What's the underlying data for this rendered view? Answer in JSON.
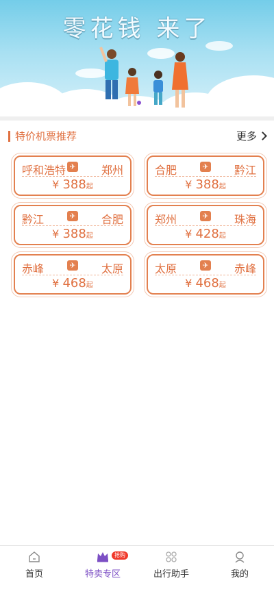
{
  "banner": {
    "title": "零花钱 来了"
  },
  "section": {
    "title": "特价机票推荐",
    "more_label": "更多"
  },
  "tickets": [
    {
      "from": "呼和浩特",
      "to": "郑州",
      "price": "388",
      "currency": "¥",
      "suffix": "起"
    },
    {
      "from": "合肥",
      "to": "黔江",
      "price": "388",
      "currency": "¥",
      "suffix": "起"
    },
    {
      "from": "黔江",
      "to": "合肥",
      "price": "388",
      "currency": "¥",
      "suffix": "起"
    },
    {
      "from": "郑州",
      "to": "珠海",
      "price": "428",
      "currency": "¥",
      "suffix": "起"
    },
    {
      "from": "赤峰",
      "to": "太原",
      "price": "468",
      "currency": "¥",
      "suffix": "起"
    },
    {
      "from": "太原",
      "to": "赤峰",
      "price": "468",
      "currency": "¥",
      "suffix": "起"
    }
  ],
  "nav": {
    "items": [
      {
        "label": "首页",
        "icon": "home-icon"
      },
      {
        "label": "特卖专区",
        "icon": "crown-icon",
        "badge": "抢购",
        "active": true
      },
      {
        "label": "出行助手",
        "icon": "grid-icon"
      },
      {
        "label": "我的",
        "icon": "profile-icon"
      }
    ]
  },
  "colors": {
    "accent": "#e07040",
    "nav_active": "#7c4fc4",
    "badge": "#f0392b"
  }
}
